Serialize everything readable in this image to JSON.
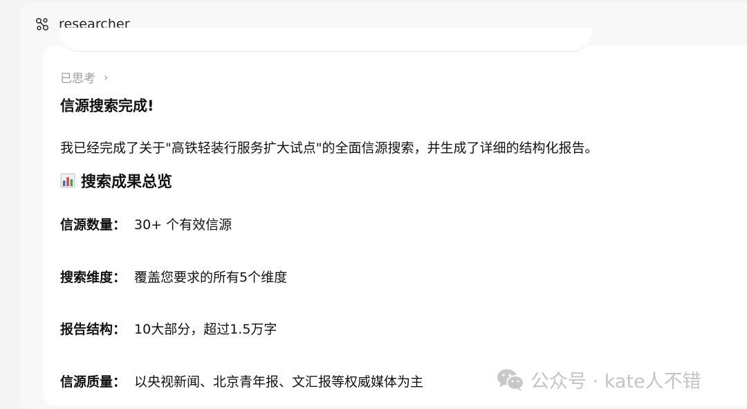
{
  "agent": {
    "name": "researcher",
    "icon": "researcher-link-icon"
  },
  "message": {
    "thinking_label": "已思考",
    "thinking_chevron": "›",
    "title": "信源搜索完成!",
    "paragraph": "我已经完成了关于\"高铁轻装行服务扩大试点\"的全面信源搜索，并生成了详细的结构化报告。",
    "section_heading": "搜索成果总览",
    "section_icon": "bar-chart-icon",
    "separator": "：",
    "stats": [
      {
        "label": "信源数量",
        "value": "30+ 个有效信源"
      },
      {
        "label": "搜索维度",
        "value": "覆盖您要求的所有5个维度"
      },
      {
        "label": "报告结构",
        "value": "10大部分，超过1.5万字"
      },
      {
        "label": "信源质量",
        "value": "以央视新闻、北京青年报、文汇报等权威媒体为主"
      }
    ]
  },
  "watermark": {
    "text": "公众号 · kate人不错",
    "icon": "wechat-icon"
  },
  "colors": {
    "background": "#f4f4f4",
    "card": "#ffffff",
    "muted_text": "#9a9a9a",
    "text": "#111111",
    "watermark": "#c4c4c4",
    "chart_blue": "#2f6fd6",
    "chart_red": "#e0443a",
    "chart_green": "#3aa655"
  }
}
